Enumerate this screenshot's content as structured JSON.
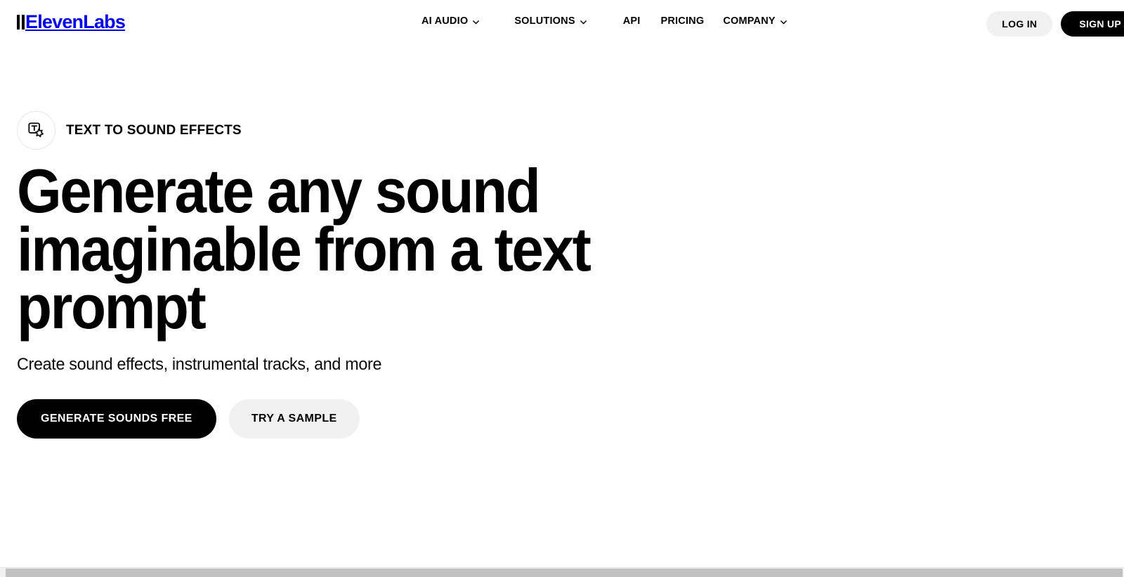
{
  "header": {
    "brand": {
      "name": "ElevenLabs",
      "logo_icon": "two-bars-logo-icon"
    },
    "nav": [
      {
        "label": "AI AUDIO",
        "has_dropdown": true,
        "icon": "chevron-down-icon"
      },
      {
        "label": "SOLUTIONS",
        "has_dropdown": true,
        "icon": "chevron-down-icon"
      },
      {
        "label": "API",
        "has_dropdown": false
      },
      {
        "label": "PRICING",
        "has_dropdown": false
      },
      {
        "label": "COMPANY",
        "has_dropdown": true,
        "icon": "chevron-down-icon"
      }
    ],
    "login_label": "LOG IN",
    "signup_label": "SIGN UP"
  },
  "hero": {
    "eyebrow": {
      "label": "TEXT TO SOUND EFFECTS",
      "icon": "text-to-sound-effects-icon"
    },
    "title": "Generate any sound imaginable from a text prompt",
    "subtitle": "Create sound effects, instrumental tracks, and more",
    "primary_cta": "GENERATE SOUNDS FREE",
    "secondary_cta": "TRY A SAMPLE"
  },
  "colors": {
    "background": "#ffffff",
    "text": "#000000",
    "button_dark": "#000000",
    "button_light": "#f1f1f1",
    "scrollbar_thumb": "#c1c1c1",
    "scrollbar_track": "#f0f0f0"
  }
}
